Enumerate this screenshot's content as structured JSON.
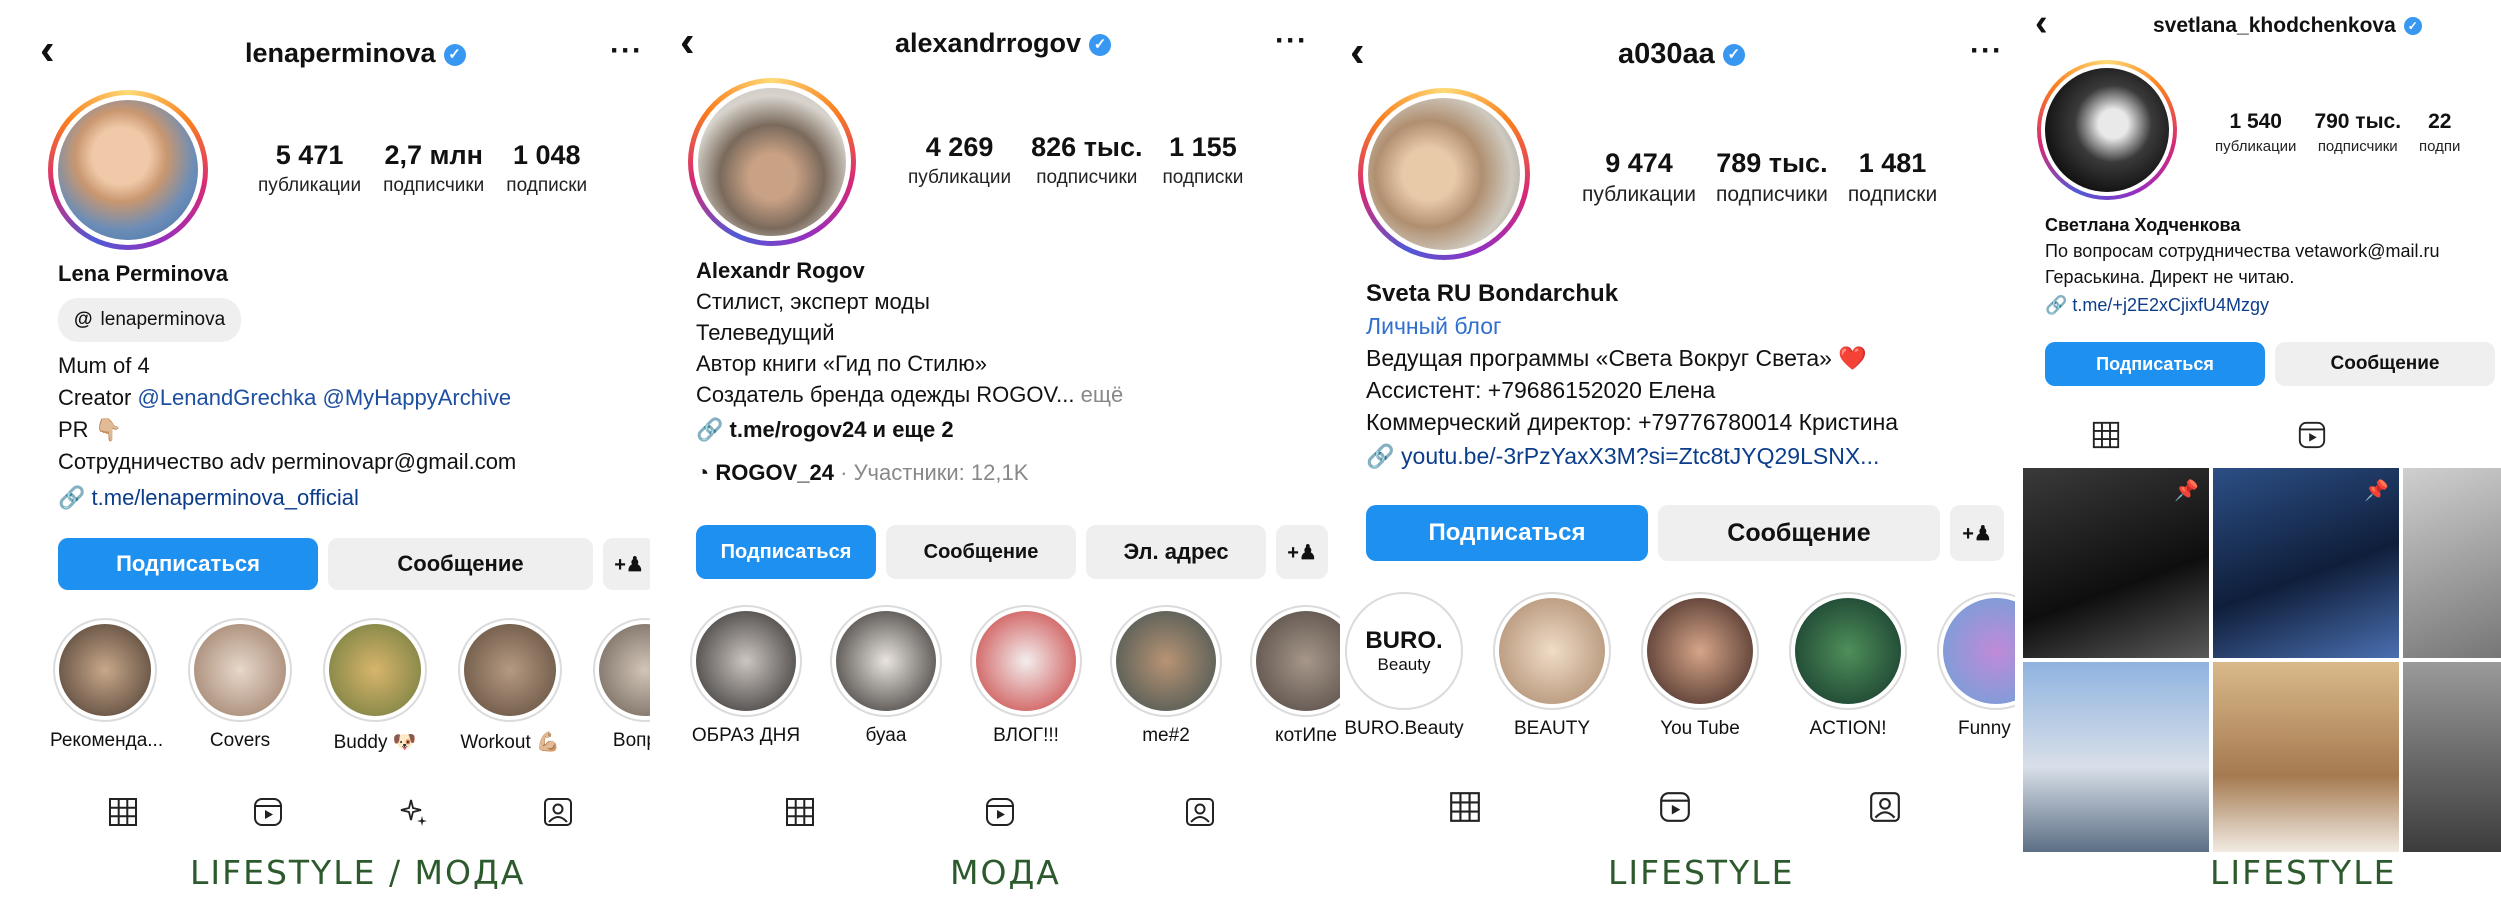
{
  "profiles": [
    {
      "username": "lenaperminova",
      "stats": [
        {
          "value": "5 471",
          "label": "публикации"
        },
        {
          "value": "2,7 млн",
          "label": "подписчики"
        },
        {
          "value": "1 048",
          "label": "подписки"
        }
      ],
      "display_name": "Lena Perminova",
      "threads_handle": "lenaperminova",
      "bio_lines": [
        "Mum of 4"
      ],
      "creator_prefix": "Creator ",
      "mentions": "@LenandGrechka @MyHappyArchive",
      "bio_pr": "PR 👇🏼",
      "bio_contact": "Сотрудничество adv perminovapr@gmail.com",
      "link": "t.me/lenaperminova_official",
      "buttons": {
        "follow": "Подписаться",
        "message": "Сообщение"
      },
      "highlights": [
        "Рекоменда...",
        "Covers",
        "Buddy 🐶",
        "Workout 💪🏼",
        "Вопрос"
      ],
      "caption": "LIFESTYLE / МОДА"
    },
    {
      "username": "alexandrrogov",
      "stats": [
        {
          "value": "4 269",
          "label": "публикации"
        },
        {
          "value": "826 тыс.",
          "label": "подписчики"
        },
        {
          "value": "1 155",
          "label": "подписки"
        }
      ],
      "display_name": "Alexandr Rogov",
      "bio_lines": [
        "Стилист, эксперт моды",
        "Телеведущий",
        "Автор книги «Гид по Стилю»"
      ],
      "bio_last": "Создатель бренда одежды ROGOV...",
      "bio_more": " ещё",
      "link": "t.me/rogov24 и еще 2",
      "channel_name": "ROGOV_24",
      "channel_members": " · Участники: 12,1K",
      "buttons": {
        "follow": "Подписаться",
        "message": "Сообщение",
        "email": "Эл. адрес"
      },
      "highlights": [
        "ОБРАЗ ДНЯ",
        "буаа",
        "ВЛОГ!!!",
        "me#2",
        "котИпе"
      ],
      "caption": "МОДА"
    },
    {
      "username": "a030aa",
      "stats": [
        {
          "value": "9 474",
          "label": "публикации"
        },
        {
          "value": "789 тыс.",
          "label": "подписчики"
        },
        {
          "value": "1 481",
          "label": "подписки"
        }
      ],
      "display_name": "Sveta RU Bondarchuk",
      "category": "Личный блог",
      "bio_lines": [
        "Ведущая программы «Света Вокруг Света» ❤️",
        "Ассистент: +79686152020 Елена",
        "Коммерческий директор: +79776780014 Кристина"
      ],
      "link": "youtu.be/-3rPzYaxX3M?si=Ztc8tJYQ29LSNX...",
      "buttons": {
        "follow": "Подписаться",
        "message": "Сообщение"
      },
      "highlights": [
        "BURO.Beauty",
        "BEAUTY",
        "You Tube",
        "ACTION!",
        "Funny St"
      ],
      "highlight_logo": {
        "line1": "BURO.",
        "line2": "Beauty"
      },
      "caption": "LIFESTYLE"
    },
    {
      "username": "svetlana_khodchenkova",
      "stats": [
        {
          "value": "1 540",
          "label": "публикации"
        },
        {
          "value": "790 тыс.",
          "label": "подписчики"
        },
        {
          "value": "22",
          "label": "подпи"
        }
      ],
      "display_name": "Светлана Ходченкова",
      "bio_lines": [
        "По вопросам сотрудничества vetawork@mail.ru",
        "Гераськина. Директ не читаю."
      ],
      "link": "t.me/+j2E2xCjixfU4Mzgy",
      "buttons": {
        "follow": "Подписаться",
        "message": "Сообщение"
      },
      "caption": "LIFESTYLE"
    }
  ],
  "colors": {
    "accent": "#1e90f0",
    "verified": "#3897f0",
    "caption": "#2d5a2d",
    "link": "#0c3d8a"
  }
}
